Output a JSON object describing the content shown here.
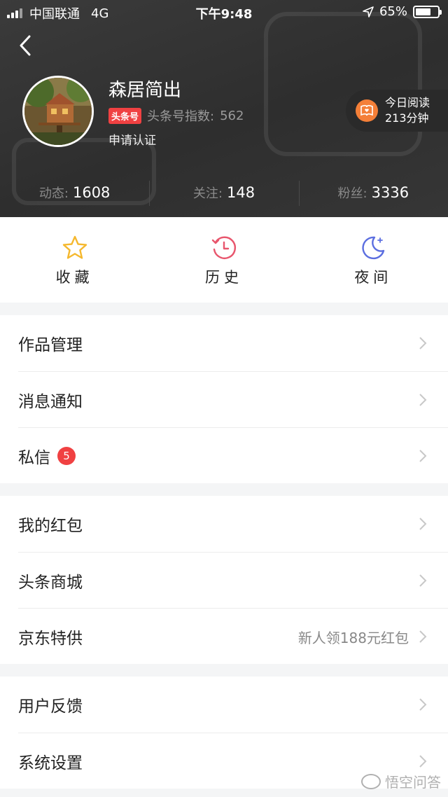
{
  "status_bar": {
    "carrier": "中国联通",
    "network": "4G",
    "time": "下午9:48",
    "battery": "65%"
  },
  "profile": {
    "name": "森居简出",
    "badge": "头条号",
    "index_label": "头条号指数:",
    "index_value": "562",
    "verify": "申请认证"
  },
  "reading": {
    "line1": "今日阅读",
    "line2": "213分钟"
  },
  "stats": [
    {
      "label": "动态:",
      "value": "1608"
    },
    {
      "label": "关注:",
      "value": "148"
    },
    {
      "label": "粉丝:",
      "value": "3336"
    }
  ],
  "actions": [
    {
      "label": "收藏",
      "icon": "star-icon"
    },
    {
      "label": "历史",
      "icon": "history-icon"
    },
    {
      "label": "夜间",
      "icon": "moon-icon"
    }
  ],
  "groups": [
    {
      "items": [
        {
          "label": "作品管理"
        },
        {
          "label": "消息通知"
        },
        {
          "label": "私信",
          "badge": "5"
        }
      ]
    },
    {
      "items": [
        {
          "label": "我的红包"
        },
        {
          "label": "头条商城"
        },
        {
          "label": "京东特供",
          "extra": "新人领188元红包"
        }
      ]
    },
    {
      "items": [
        {
          "label": "用户反馈"
        },
        {
          "label": "系统设置"
        }
      ]
    }
  ],
  "watermark": "悟空问答",
  "colors": {
    "accent_red": "#f04142",
    "reading_orange": "#f47f38",
    "star": "#f5b82e",
    "history": "#e8566d",
    "moon": "#5b6ee0"
  }
}
